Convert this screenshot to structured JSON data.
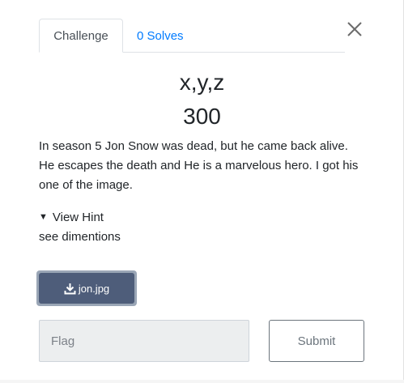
{
  "tabs": {
    "challenge_label": "Challenge",
    "solves_label": "0 Solves"
  },
  "challenge": {
    "name": "x,y,z",
    "points": "300",
    "description": "In season 5 Jon Snow was dead, but he came back alive. He escapes the death and He is a marvelous hero. I got his one of the image."
  },
  "hint": {
    "toggle_label": "View Hint",
    "content": "see dimentions"
  },
  "file": {
    "name": "jon.jpg",
    "icon": "download-icon"
  },
  "flag": {
    "placeholder": "Flag",
    "value": ""
  },
  "submit": {
    "label": "Submit"
  },
  "colors": {
    "link": "#007bff",
    "file_button": "#4e5d7a",
    "submit_border": "#6c757d",
    "input_bg": "#eceeef"
  }
}
